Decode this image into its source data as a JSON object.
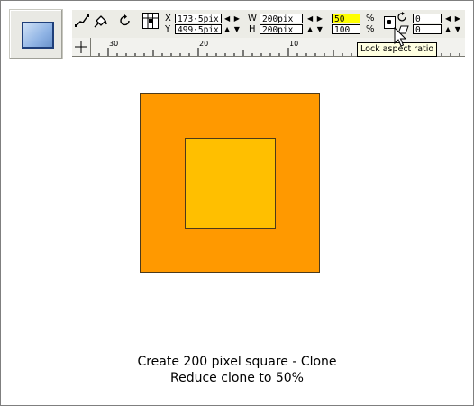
{
  "toolbar": {
    "x_label": "X",
    "y_label": "Y",
    "x_value": "173·5pix",
    "y_value": "499·5pix",
    "w_label": "W",
    "h_label": "H",
    "w_value": "200pix",
    "h_value": "200pix",
    "scale_w_percent": "50",
    "scale_h_percent": "100",
    "percent_symbol": "%",
    "rotation_value": "0",
    "skew_value": "0",
    "icons": [
      "shape-editor-icon",
      "fill-tool-icon",
      "rotate-icon",
      "grid-selector-icon",
      "lock-aspect-icon",
      "rotate-angle-icon",
      "skew-icon"
    ]
  },
  "ruler": {
    "labels": [
      "30",
      "20",
      "10"
    ]
  },
  "tooltip": {
    "text": "Lock aspect ratio"
  },
  "canvas": {
    "outer_color": "#ff9900",
    "inner_color": "#ffbf00"
  },
  "caption": {
    "line1": "Create 200 pixel square - Clone",
    "line2": "Reduce clone to 50%"
  }
}
